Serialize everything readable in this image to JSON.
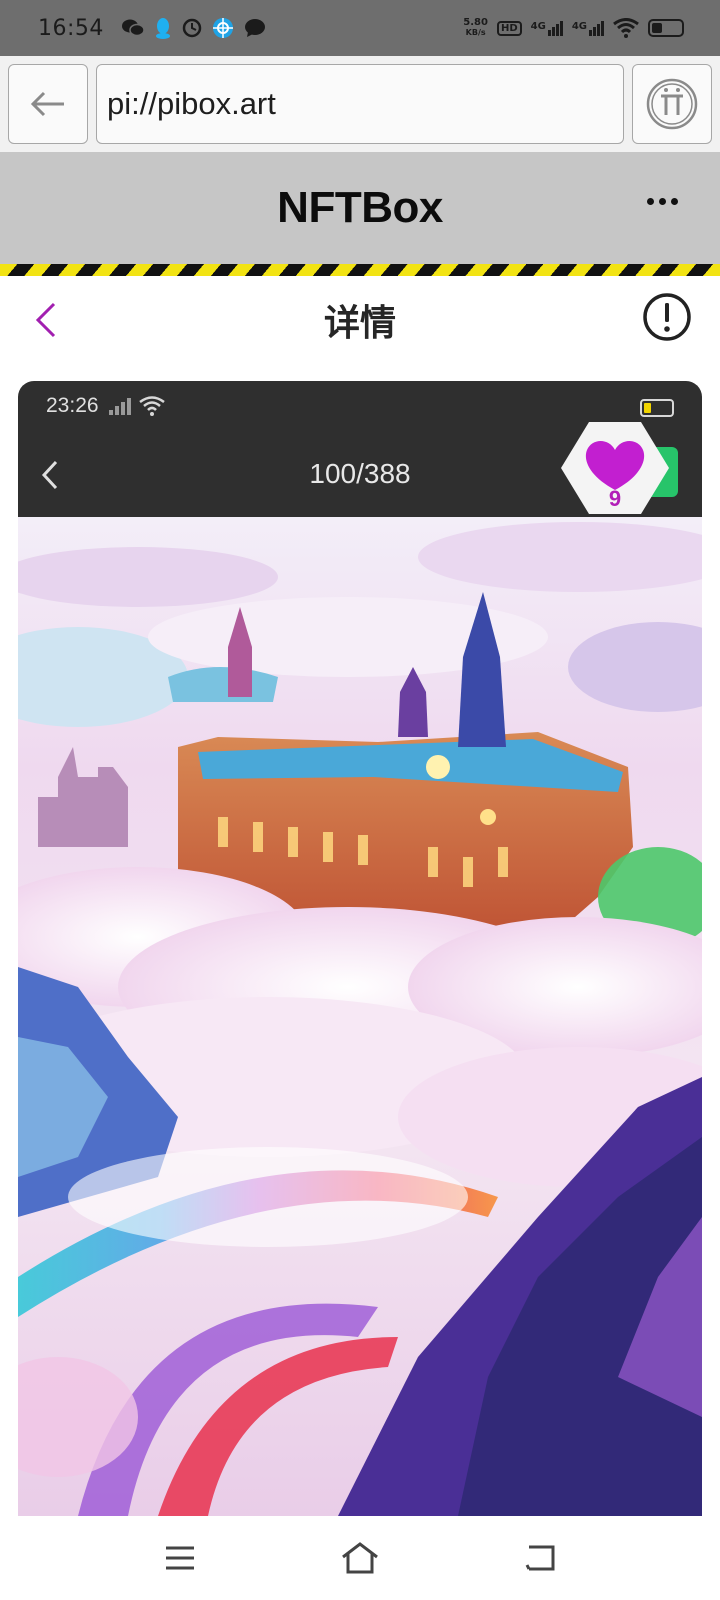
{
  "status_bar": {
    "time": "16:54",
    "app_icons": [
      "wechat-icon",
      "qq-icon",
      "clock-app-icon",
      "browser-app-icon",
      "message-icon"
    ],
    "network_speed_value": "5.80",
    "network_speed_unit": "KB/s",
    "hd_label": "HD",
    "net1_label": "4G",
    "net2_label": "4G",
    "battery_level": 0.3
  },
  "browser": {
    "url": "pi://pibox.art",
    "back_icon": "arrow-left-icon",
    "pi_icon": "pi-logo-icon"
  },
  "app_header": {
    "title": "NFTBox",
    "menu_icon": "more-dots-icon"
  },
  "detail_header": {
    "title": "详情",
    "back_icon": "chevron-left-icon",
    "info_icon": "info-icon"
  },
  "inner_screenshot": {
    "time": "23:26",
    "counter": "100/388",
    "battery_level": 0.2
  },
  "like": {
    "count": "9",
    "icon": "heart-icon"
  },
  "bottom_nav": {
    "items": [
      "menu-icon",
      "home-icon",
      "back-icon"
    ]
  },
  "colors": {
    "accent_purple": "#a21fb0",
    "hazard_yellow": "#f2e313",
    "header_gray": "#c6c6c6",
    "status_gray": "#6e6e6e"
  }
}
